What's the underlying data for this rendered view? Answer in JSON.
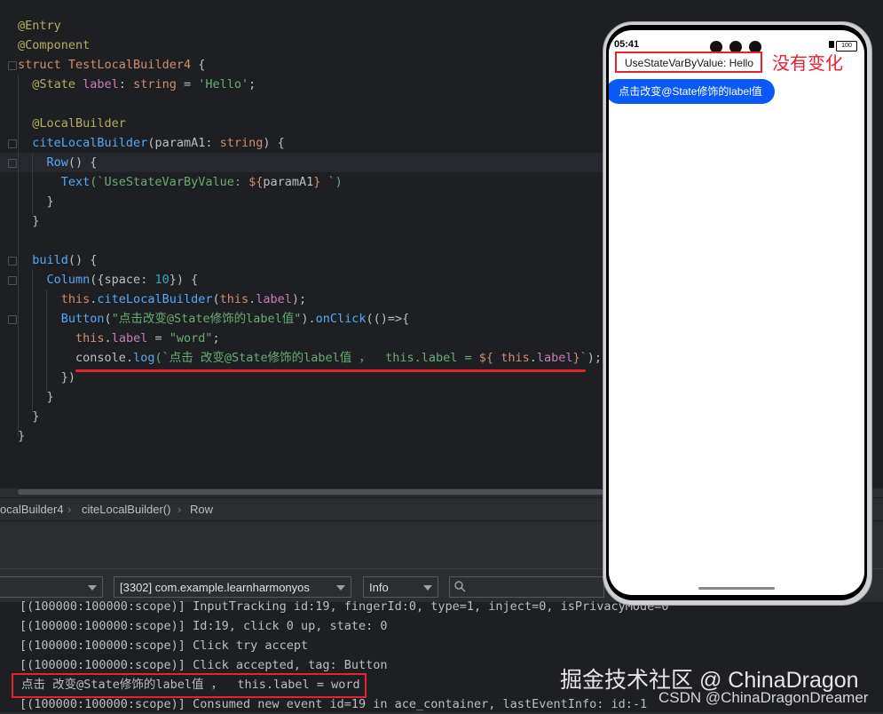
{
  "editor": {
    "lines": [
      {
        "parts": [
          {
            "t": "@Entry",
            "c": "ann"
          }
        ]
      },
      {
        "parts": [
          {
            "t": "@Component",
            "c": "ann"
          }
        ]
      },
      {
        "parts": [
          {
            "t": "struct ",
            "c": "kw"
          },
          {
            "t": "TestLocalBuilder4 ",
            "c": "cls"
          },
          {
            "t": "{",
            "c": "plain"
          }
        ]
      },
      {
        "parts": [
          {
            "t": "  @State ",
            "c": "ann"
          },
          {
            "t": "label",
            "c": "prop"
          },
          {
            "t": ": ",
            "c": "plain"
          },
          {
            "t": "string",
            "c": "ty"
          },
          {
            "t": " = ",
            "c": "plain"
          },
          {
            "t": "'Hello'",
            "c": "str"
          },
          {
            "t": ";",
            "c": "plain"
          }
        ]
      },
      {
        "parts": [
          {
            "t": "",
            "c": "plain"
          }
        ]
      },
      {
        "parts": [
          {
            "t": "  @LocalBuilder",
            "c": "ann"
          }
        ]
      },
      {
        "parts": [
          {
            "t": "  citeLocalBuilder",
            "c": "fn"
          },
          {
            "t": "(paramA1: ",
            "c": "plain"
          },
          {
            "t": "string",
            "c": "ty"
          },
          {
            "t": ") {",
            "c": "plain"
          }
        ]
      },
      {
        "parts": [
          {
            "t": "    Row",
            "c": "fn"
          },
          {
            "t": "() {",
            "c": "plain"
          }
        ]
      },
      {
        "parts": [
          {
            "t": "      Text",
            "c": "fn"
          },
          {
            "t": "(`UseStateVarByValue: ",
            "c": "tpl"
          },
          {
            "t": "${",
            "c": "orange"
          },
          {
            "t": "paramA1",
            "c": "plain"
          },
          {
            "t": "}",
            "c": "orange"
          },
          {
            "t": " `)",
            "c": "tpl"
          }
        ]
      },
      {
        "parts": [
          {
            "t": "    }",
            "c": "plain"
          }
        ]
      },
      {
        "parts": [
          {
            "t": "  }",
            "c": "plain"
          }
        ]
      },
      {
        "parts": [
          {
            "t": "",
            "c": "plain"
          }
        ]
      },
      {
        "parts": [
          {
            "t": "  build",
            "c": "fn"
          },
          {
            "t": "() {",
            "c": "plain"
          }
        ]
      },
      {
        "parts": [
          {
            "t": "    Column",
            "c": "fn"
          },
          {
            "t": "({",
            "c": "plain"
          },
          {
            "t": "space",
            "c": "plain"
          },
          {
            "t": ": ",
            "c": "plain"
          },
          {
            "t": "10",
            "c": "num"
          },
          {
            "t": "}) {",
            "c": "plain"
          }
        ]
      },
      {
        "parts": [
          {
            "t": "      this",
            "c": "kw"
          },
          {
            "t": ".",
            "c": "plain"
          },
          {
            "t": "citeLocalBuilder",
            "c": "fn"
          },
          {
            "t": "(",
            "c": "plain"
          },
          {
            "t": "this",
            "c": "kw"
          },
          {
            "t": ".",
            "c": "plain"
          },
          {
            "t": "label",
            "c": "prop"
          },
          {
            "t": ");",
            "c": "plain"
          }
        ]
      },
      {
        "parts": [
          {
            "t": "      Button",
            "c": "fn"
          },
          {
            "t": "(",
            "c": "plain"
          },
          {
            "t": "\"点击改变@State修饰的label值\"",
            "c": "str"
          },
          {
            "t": ").",
            "c": "plain"
          },
          {
            "t": "onClick",
            "c": "fn"
          },
          {
            "t": "(()=>{",
            "c": "plain"
          }
        ]
      },
      {
        "parts": [
          {
            "t": "        this",
            "c": "kw"
          },
          {
            "t": ".",
            "c": "plain"
          },
          {
            "t": "label",
            "c": "prop"
          },
          {
            "t": " = ",
            "c": "plain"
          },
          {
            "t": "\"word\"",
            "c": "str"
          },
          {
            "t": ";",
            "c": "plain"
          }
        ]
      },
      {
        "parts": [
          {
            "t": "        console",
            "c": "plain"
          },
          {
            "t": ".",
            "c": "plain"
          },
          {
            "t": "log",
            "c": "fn"
          },
          {
            "t": "(`点击 改变@State修饰的label值 ，  this.label = ",
            "c": "tpl"
          },
          {
            "t": "${ ",
            "c": "orange"
          },
          {
            "t": "this",
            "c": "kw"
          },
          {
            "t": ".",
            "c": "plain"
          },
          {
            "t": "label",
            "c": "prop"
          },
          {
            "t": "}",
            "c": "orange"
          },
          {
            "t": "`",
            "c": "tpl"
          },
          {
            "t": ");",
            "c": "plain"
          }
        ]
      },
      {
        "parts": [
          {
            "t": "      })",
            "c": "plain"
          }
        ]
      },
      {
        "parts": [
          {
            "t": "    }",
            "c": "plain"
          }
        ]
      },
      {
        "parts": [
          {
            "t": "  }",
            "c": "plain"
          }
        ]
      },
      {
        "parts": [
          {
            "t": "}",
            "c": "plain"
          }
        ]
      }
    ]
  },
  "breadcrumb": {
    "items": [
      "ocalBuilder4",
      "citeLocalBuilder()",
      "Row"
    ]
  },
  "toolbar": {
    "device_value": "",
    "process_value": "[3302] com.example.learnharmonyos",
    "level_value": "Info",
    "search_placeholder": ""
  },
  "log": {
    "lines": [
      "[(100000:100000:scope)] InputTracking id:19, fingerId:0, type=1, inject=0, isPrivacyMode=0",
      "[(100000:100000:scope)] Id:19, click 0 up, state: 0",
      "[(100000:100000:scope)] Click try accept",
      "[(100000:100000:scope)] Click accepted, tag: Button",
      "点击 改变@State修饰的label值 ，  this.label = word",
      "[(100000:100000:scope)] Consumed new event id=19 in ace_container, lastEventInfo: id:-1"
    ]
  },
  "phone": {
    "time": "05:41",
    "battery": "100",
    "text": "UseStateVarByValue: Hello",
    "button_label": "点击改变@State修饰的label值"
  },
  "annotation": "没有变化",
  "watermark": {
    "line1": "掘金技术社区 @ ChinaDragon",
    "line2": "CSDN @ChinaDragonDreamer"
  }
}
